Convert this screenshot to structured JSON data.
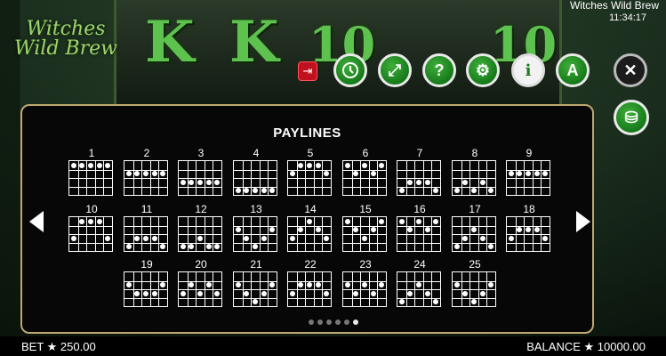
{
  "game": {
    "title": "Witches Wild Brew",
    "time": "11:34:17",
    "logo": "Witches Wild Brew"
  },
  "reel_symbols": [
    "K",
    "K",
    "10",
    "10"
  ],
  "toolbar": [
    {
      "name": "exit-button",
      "icon": "exit-icon"
    },
    {
      "name": "history-button",
      "icon": "clock-icon"
    },
    {
      "name": "fullscreen-button",
      "icon": "expand-icon",
      "glyph": "⤢"
    },
    {
      "name": "help-button",
      "icon": "question-icon",
      "glyph": "?"
    },
    {
      "name": "settings-button",
      "icon": "gear-icon",
      "glyph": "⚙"
    },
    {
      "name": "info-button",
      "icon": "info-icon",
      "glyph": "i"
    },
    {
      "name": "autoplay-button",
      "icon": "autoplay-icon",
      "glyph": "A"
    },
    {
      "name": "close-button",
      "icon": "close-icon",
      "glyph": "✕"
    },
    {
      "name": "coins-button",
      "icon": "coins-icon",
      "glyph": "⛁"
    }
  ],
  "paytable": {
    "title": "PAYLINES",
    "lines": [
      {
        "n": "1",
        "rows": [
          0,
          0,
          0,
          0,
          0
        ]
      },
      {
        "n": "2",
        "rows": [
          1,
          1,
          1,
          1,
          1
        ]
      },
      {
        "n": "3",
        "rows": [
          2,
          2,
          2,
          2,
          2
        ]
      },
      {
        "n": "4",
        "rows": [
          3,
          3,
          3,
          3,
          3
        ]
      },
      {
        "n": "5",
        "rows": [
          1,
          0,
          0,
          0,
          1
        ]
      },
      {
        "n": "6",
        "rows": [
          0,
          1,
          0,
          1,
          0
        ]
      },
      {
        "n": "7",
        "rows": [
          3,
          2,
          2,
          2,
          3
        ]
      },
      {
        "n": "8",
        "rows": [
          3,
          2,
          3,
          2,
          3
        ]
      },
      {
        "n": "9",
        "rows": [
          1,
          1,
          1,
          1,
          1
        ]
      },
      {
        "n": "10",
        "rows": [
          2,
          0,
          0,
          0,
          2
        ]
      },
      {
        "n": "11",
        "rows": [
          3,
          2,
          2,
          2,
          3
        ]
      },
      {
        "n": "12",
        "rows": [
          3,
          3,
          2,
          3,
          3
        ]
      },
      {
        "n": "13",
        "rows": [
          1,
          2,
          3,
          2,
          1
        ]
      },
      {
        "n": "14",
        "rows": [
          2,
          1,
          0,
          1,
          2
        ]
      },
      {
        "n": "15",
        "rows": [
          0,
          1,
          2,
          1,
          0
        ]
      },
      {
        "n": "16",
        "rows": [
          0,
          1,
          0,
          1,
          0
        ]
      },
      {
        "n": "17",
        "rows": [
          3,
          2,
          1,
          2,
          3
        ]
      },
      {
        "n": "18",
        "rows": [
          2,
          1,
          1,
          1,
          2
        ]
      },
      {
        "n": "19",
        "rows": [
          1,
          2,
          2,
          2,
          1
        ]
      },
      {
        "n": "20",
        "rows": [
          2,
          1,
          2,
          1,
          2
        ]
      },
      {
        "n": "21",
        "rows": [
          1,
          2,
          3,
          2,
          1
        ]
      },
      {
        "n": "22",
        "rows": [
          2,
          1,
          1,
          1,
          2
        ]
      },
      {
        "n": "23",
        "rows": [
          1,
          2,
          1,
          2,
          1
        ]
      },
      {
        "n": "24",
        "rows": [
          3,
          2,
          1,
          2,
          3
        ]
      },
      {
        "n": "25",
        "rows": [
          1,
          2,
          3,
          2,
          1
        ]
      }
    ],
    "pages": 6,
    "current_page": 6
  },
  "footer": {
    "bet": "BET ★ 250.00",
    "balance": "BALANCE ★ 10000.00"
  }
}
